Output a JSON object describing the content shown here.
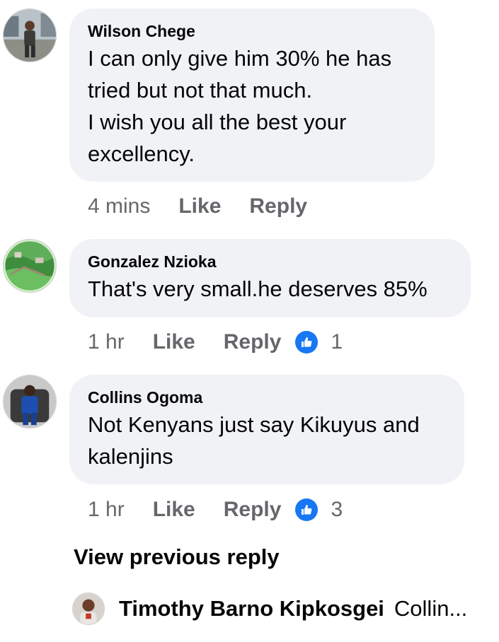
{
  "comments": [
    {
      "author": "Wilson Chege",
      "text": "I can only give him 30%  he has\ntried but not that much.\nI wish you all the best your\nexcellency.",
      "time": "4 mins",
      "like_label": "Like",
      "reply_label": "Reply",
      "avatar_icon": "person-photo-avatar"
    },
    {
      "author": "Gonzalez Nzioka",
      "text": "That's very small.he deserves 85%",
      "time": "1 hr",
      "like_label": "Like",
      "reply_label": "Reply",
      "reaction_count": "1",
      "reaction_icon": "thumbs-up-icon",
      "avatar_icon": "landscape-photo-avatar"
    },
    {
      "author": "Collins Ogoma",
      "text": "Not Kenyans just say Kikuyus and\nkalenjins",
      "time": "1 hr",
      "like_label": "Like",
      "reply_label": "Reply",
      "reaction_count": "3",
      "reaction_icon": "thumbs-up-icon",
      "avatar_icon": "person-photo-avatar"
    }
  ],
  "view_previous": "View previous reply",
  "reply_preview": {
    "author": "Timothy Barno Kipkosgei",
    "snippet": "Collin...",
    "avatar_icon": "person-photo-avatar"
  },
  "colors": {
    "bubble": "#f0f2f5",
    "meta_text": "#65676b",
    "like_blue": "#1877f2",
    "text": "#050505"
  }
}
